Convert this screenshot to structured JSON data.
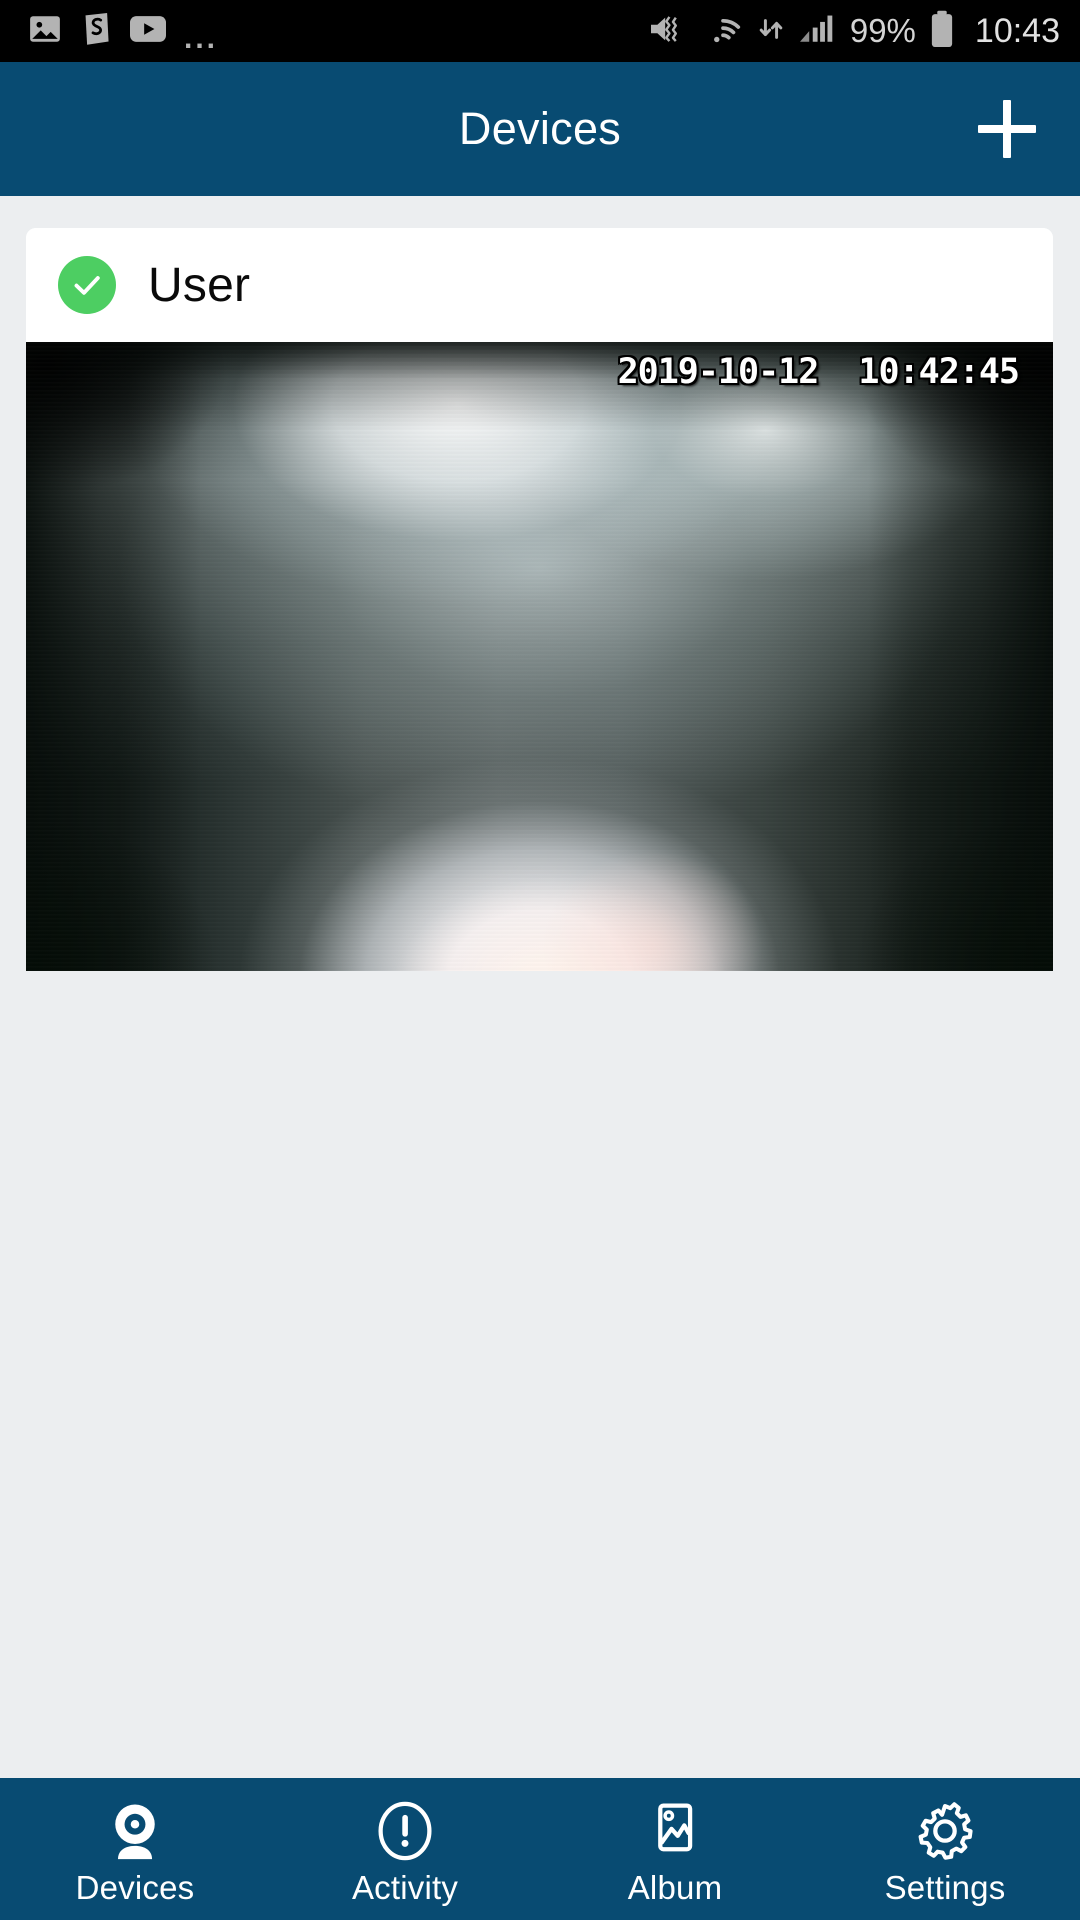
{
  "statusbar": {
    "left_icons": [
      {
        "name": "photo-icon",
        "label": "Photos"
      },
      {
        "name": "shazam-s-icon",
        "label": "S"
      },
      {
        "name": "youtube-icon",
        "label": "YouTube"
      },
      {
        "name": "more-notifications-icon",
        "label": "..."
      }
    ],
    "right_icons": [
      {
        "name": "mute-vibrate-icon",
        "label": "Sound off / vibrate"
      },
      {
        "name": "wifi-icon",
        "label": "Wi-Fi"
      },
      {
        "name": "data-transfer-icon",
        "label": "Data up/down"
      },
      {
        "name": "cellular-signal-icon",
        "label": "Signal"
      }
    ],
    "battery_percent": "99%",
    "battery_icon": "battery-icon",
    "time": "10:43"
  },
  "header": {
    "title": "Devices",
    "add_button_label": "+",
    "background_color": "#084b72"
  },
  "device_card": {
    "status_icon": "check-circle-icon",
    "status_color": "#4dce62",
    "name": "User",
    "feed": {
      "timestamp": "2019-10-12  10:42:45",
      "date": "2019-10-12",
      "time": "10:42:45"
    }
  },
  "navbar": {
    "background_color": "#084b72",
    "items": [
      {
        "label": "Devices",
        "icon": "webcam-icon",
        "active": true
      },
      {
        "label": "Activity",
        "icon": "exclamation-circle-icon",
        "active": false
      },
      {
        "label": "Album",
        "icon": "image-frame-icon",
        "active": false
      },
      {
        "label": "Settings",
        "icon": "gear-icon",
        "active": false
      }
    ]
  }
}
